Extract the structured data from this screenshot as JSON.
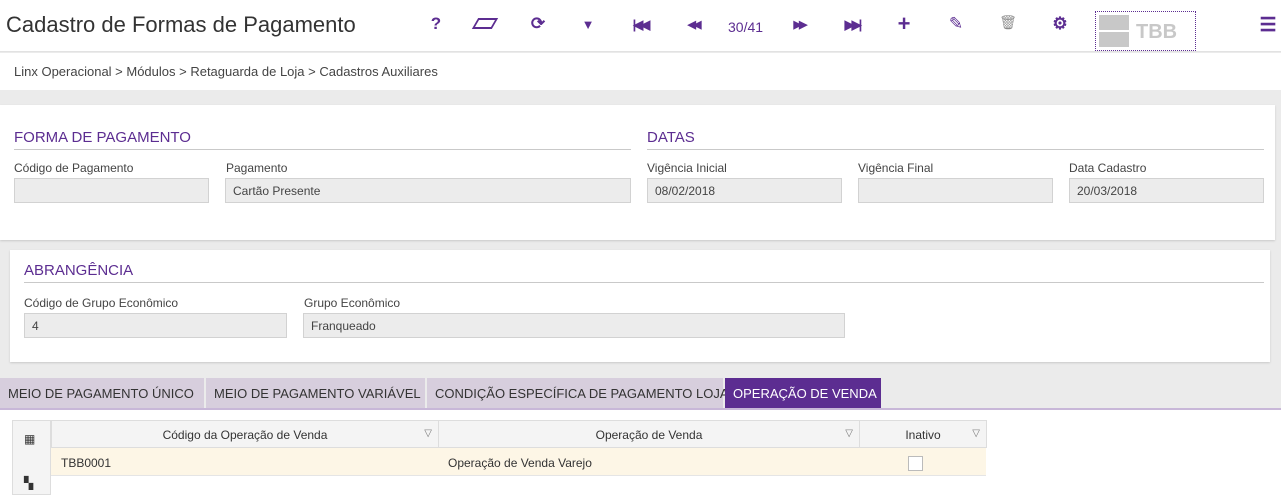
{
  "header": {
    "title": "Cadastro de Formas de Pagamento",
    "counter": "30/41",
    "logo": "TBB"
  },
  "toolbar": {
    "help": "?",
    "eraser": "▰",
    "refresh": "⟳",
    "filter": "▼",
    "first": "⏮",
    "prev": "◀◀",
    "next": "▶▶",
    "last": "⏭",
    "add": "+",
    "edit": "✎",
    "delete": "🗑",
    "settings": "⚙",
    "menu": "☰"
  },
  "breadcrumb": "Linx Operacional  >  Módulos  >  Retaguarda de Loja  >  Cadastros Auxiliares",
  "forma": {
    "title": "FORMA DE PAGAMENTO",
    "codigo_label": "Código de Pagamento",
    "codigo_value": "",
    "pagamento_label": "Pagamento",
    "pagamento_value": "Cartão Presente"
  },
  "datas": {
    "title": "DATAS",
    "vig_ini_label": "Vigência Inicial",
    "vig_ini_value": "08/02/2018",
    "vig_fim_label": "Vigência Final",
    "vig_fim_value": "",
    "cad_label": "Data Cadastro",
    "cad_value": "20/03/2018"
  },
  "abrangencia": {
    "title": "ABRANGÊNCIA",
    "cod_label": "Código de Grupo Econômico",
    "cod_value": "4",
    "grupo_label": "Grupo Econômico",
    "grupo_value": "Franqueado"
  },
  "tabs": [
    "MEIO DE PAGAMENTO ÚNICO",
    "MEIO DE PAGAMENTO VARIÁVEL",
    "CONDIÇÃO ESPECÍFICA DE PAGAMENTO LOJA",
    "OPERAÇÃO DE VENDA"
  ],
  "grid": {
    "columns": [
      "Código da Operação de Venda",
      "Operação de Venda",
      "Inativo"
    ],
    "rows": [
      {
        "codigo": "TBB0001",
        "operacao": "Operação de Venda Varejo",
        "inativo": false
      }
    ]
  }
}
